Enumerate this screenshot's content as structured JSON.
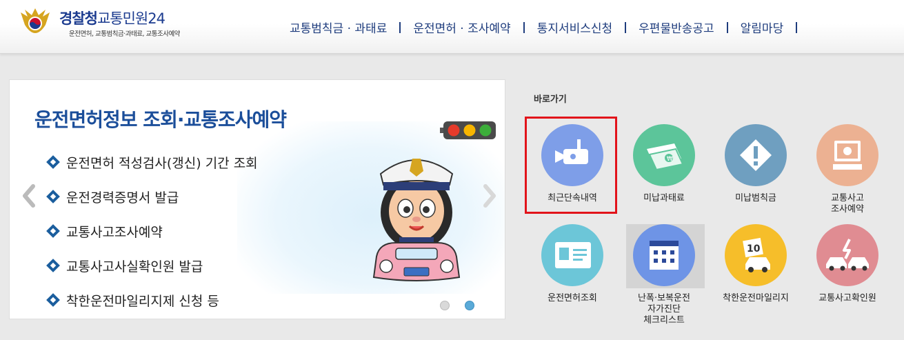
{
  "header": {
    "logo_title_main": "경찰청",
    "logo_title_accent": "교통민원24",
    "logo_subtitle": "운전면허, 교통범칙금·과태료, 교통조사예약",
    "nav": [
      "교통범칙금 · 과태료",
      "운전면허 · 조사예약",
      "통지서비스신청",
      "우편물반송공고",
      "알림마당"
    ]
  },
  "banner": {
    "title": "운전면허정보 조회·교통조사예약",
    "items": [
      "운전면허 적성검사(갱신) 기간 조회",
      "운전경력증명서 발급",
      "교통사고조사예약",
      "교통사고사실확인원 발급",
      "착한운전마일리지제 신청 등"
    ],
    "current_slide": 2,
    "slide_count": 2
  },
  "shortcuts": {
    "title": "바로가기",
    "items": [
      {
        "label": "최근단속내역",
        "icon": "camera-icon",
        "color": "#7e9ee8"
      },
      {
        "label": "미납과태료",
        "icon": "money-icon",
        "color": "#5cc59a"
      },
      {
        "label": "미납범칙금",
        "icon": "warning-icon",
        "color": "#6f9fc0"
      },
      {
        "label": "교통사고\n조사예약",
        "icon": "monitor-icon",
        "color": "#ecb192"
      },
      {
        "label": "운전면허조회",
        "icon": "id-card-icon",
        "color": "#6cc6d8"
      },
      {
        "label": "난폭·보복운전\n자가진단\n체크리스트",
        "icon": "calendar-icon",
        "color": "#6e94e6"
      },
      {
        "label": "착한운전마일리지",
        "icon": "car-10-icon",
        "color": "#f6be2a"
      },
      {
        "label": "교통사고확인원",
        "icon": "crash-icon",
        "color": "#e08c92"
      }
    ]
  },
  "colors": {
    "brand": "#1b3b8f",
    "highlight": "#e2131a"
  }
}
